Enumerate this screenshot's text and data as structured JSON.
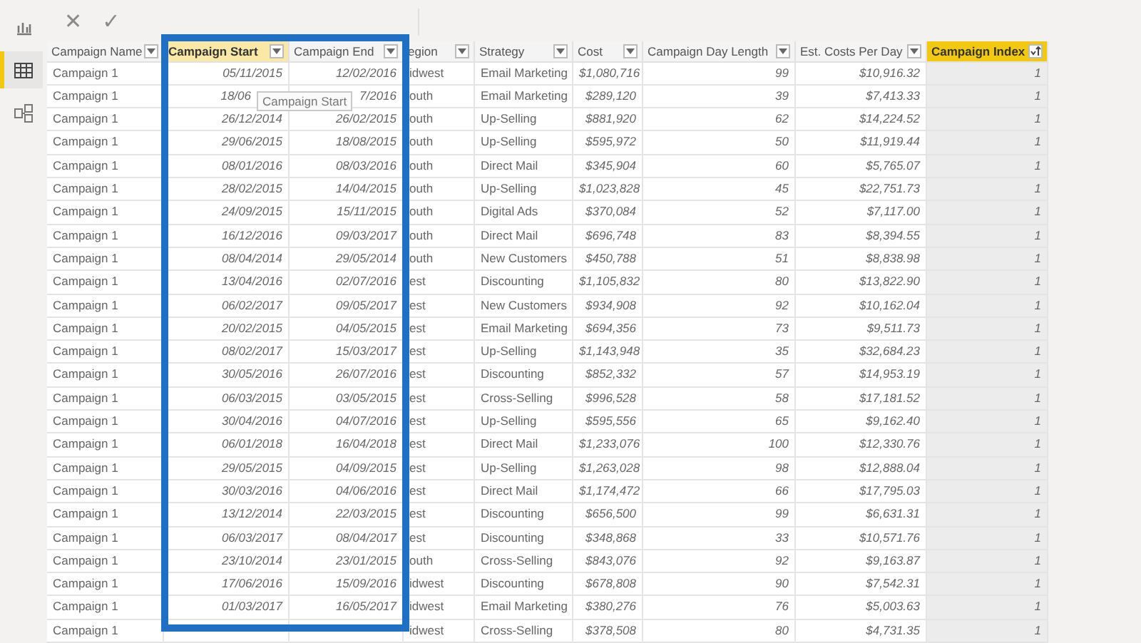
{
  "rail": {
    "items": [
      {
        "kind": "report",
        "selected": false
      },
      {
        "kind": "data",
        "selected": true
      },
      {
        "kind": "model",
        "selected": false
      }
    ]
  },
  "formula_bar": {
    "cancel": "✕",
    "commit": "✓"
  },
  "table": {
    "columns": [
      {
        "label": "Campaign Name",
        "kind": "text",
        "selected": false,
        "sorted": false
      },
      {
        "label": "Campaign Start",
        "kind": "number",
        "selected": false,
        "hovered": true,
        "sorted": false
      },
      {
        "label": "Campaign End",
        "kind": "number",
        "selected": false,
        "sorted": false
      },
      {
        "label": "egion",
        "kind": "text",
        "selected": false,
        "sorted": false
      },
      {
        "label": "Strategy",
        "kind": "text",
        "selected": false,
        "sorted": false
      },
      {
        "label": "Cost",
        "kind": "number",
        "selected": false,
        "sorted": false
      },
      {
        "label": "Campaign Day Length",
        "kind": "number",
        "selected": false,
        "sorted": false
      },
      {
        "label": "Est. Costs Per Day",
        "kind": "number",
        "selected": false,
        "sorted": false
      },
      {
        "label": "Campaign Index",
        "kind": "number",
        "selected": true,
        "sorted": true
      }
    ],
    "rows": [
      [
        "Campaign 1",
        "05/11/2015",
        "12/02/2016",
        "idwest",
        "Email Marketing",
        "$1,080,716",
        "99",
        "$10,916.32",
        "1"
      ],
      [
        "Campaign 1",
        {
          "text": "18/06",
          "covered": true
        },
        "7/2016",
        "outh",
        "Email Marketing",
        "$289,120",
        "39",
        "$7,413.33",
        "1"
      ],
      [
        "Campaign 1",
        "26/12/2014",
        "26/02/2015",
        "outh",
        "Up-Selling",
        "$881,920",
        "62",
        "$14,224.52",
        "1"
      ],
      [
        "Campaign 1",
        "29/06/2015",
        "18/08/2015",
        "outh",
        "Up-Selling",
        "$595,972",
        "50",
        "$11,919.44",
        "1"
      ],
      [
        "Campaign 1",
        "08/01/2016",
        "08/03/2016",
        "outh",
        "Direct Mail",
        "$345,904",
        "60",
        "$5,765.07",
        "1"
      ],
      [
        "Campaign 1",
        "28/02/2015",
        "14/04/2015",
        "outh",
        "Up-Selling",
        "$1,023,828",
        "45",
        "$22,751.73",
        "1"
      ],
      [
        "Campaign 1",
        "24/09/2015",
        "15/11/2015",
        "outh",
        "Digital Ads",
        "$370,084",
        "52",
        "$7,117.00",
        "1"
      ],
      [
        "Campaign 1",
        "16/12/2016",
        "09/03/2017",
        "outh",
        "Direct Mail",
        "$696,748",
        "83",
        "$8,394.55",
        "1"
      ],
      [
        "Campaign 1",
        "08/04/2014",
        "29/05/2014",
        "outh",
        "New Customers",
        "$450,788",
        "51",
        "$8,838.98",
        "1"
      ],
      [
        "Campaign 1",
        "13/04/2016",
        "02/07/2016",
        "est",
        "Discounting",
        "$1,105,832",
        "80",
        "$13,822.90",
        "1"
      ],
      [
        "Campaign 1",
        "06/02/2017",
        "09/05/2017",
        "est",
        "New Customers",
        "$934,908",
        "92",
        "$10,162.04",
        "1"
      ],
      [
        "Campaign 1",
        "20/02/2015",
        "04/05/2015",
        "est",
        "Email Marketing",
        "$694,356",
        "73",
        "$9,511.73",
        "1"
      ],
      [
        "Campaign 1",
        "08/02/2017",
        "15/03/2017",
        "est",
        "Up-Selling",
        "$1,143,948",
        "35",
        "$32,684.23",
        "1"
      ],
      [
        "Campaign 1",
        "30/05/2016",
        "26/07/2016",
        "est",
        "Discounting",
        "$852,332",
        "57",
        "$14,953.19",
        "1"
      ],
      [
        "Campaign 1",
        "06/03/2015",
        "03/05/2015",
        "est",
        "Cross-Selling",
        "$996,528",
        "58",
        "$17,181.52",
        "1"
      ],
      [
        "Campaign 1",
        "30/04/2016",
        "04/07/2016",
        "est",
        "Up-Selling",
        "$595,556",
        "65",
        "$9,162.40",
        "1"
      ],
      [
        "Campaign 1",
        "06/01/2018",
        "16/04/2018",
        "est",
        "Direct Mail",
        "$1,233,076",
        "100",
        "$12,330.76",
        "1"
      ],
      [
        "Campaign 1",
        "29/05/2015",
        "04/09/2015",
        "est",
        "Up-Selling",
        "$1,263,028",
        "98",
        "$12,888.04",
        "1"
      ],
      [
        "Campaign 1",
        "30/03/2016",
        "04/06/2016",
        "est",
        "Direct Mail",
        "$1,174,472",
        "66",
        "$17,795.03",
        "1"
      ],
      [
        "Campaign 1",
        "13/12/2014",
        "22/03/2015",
        "est",
        "Discounting",
        "$656,500",
        "99",
        "$6,631.31",
        "1"
      ],
      [
        "Campaign 1",
        "06/03/2017",
        "08/04/2017",
        "est",
        "Discounting",
        "$348,868",
        "33",
        "$10,571.76",
        "1"
      ],
      [
        "Campaign 1",
        "23/10/2014",
        "23/01/2015",
        "outh",
        "Cross-Selling",
        "$843,076",
        "92",
        "$9,163.87",
        "1"
      ],
      [
        "Campaign 1",
        "17/06/2016",
        "15/09/2016",
        "idwest",
        "Discounting",
        "$678,808",
        "90",
        "$7,542.31",
        "1"
      ],
      [
        "Campaign 1",
        "01/03/2017",
        "16/05/2017",
        "idwest",
        "Email Marketing",
        "$380,276",
        "76",
        "$5,003.63",
        "1"
      ],
      [
        "Campaign 1",
        null,
        null,
        "idwest",
        "Cross-Selling",
        "$378,508",
        "80",
        "$4,731.35",
        "1"
      ]
    ]
  },
  "tooltip": "Campaign Start"
}
